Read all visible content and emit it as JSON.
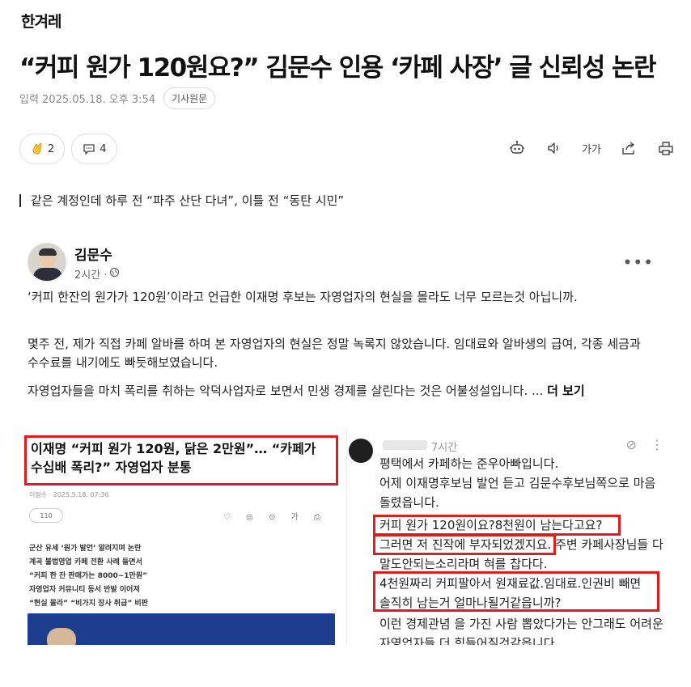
{
  "brand": {
    "logo": "한겨레"
  },
  "article": {
    "headline": "“커피 원가 120원요?” 김문수 인용 ‘카페 사장’ 글 신뢰성 논란",
    "date": "입력 2025.05.18. 오후 3:54",
    "source_button": "기사원문",
    "subhead": "같은 계정인데 하루 전 “파주 산단 다녀”, 이틀 전 “동탄 시민”"
  },
  "reactions": {
    "like_count": "2",
    "comment_count": "4"
  },
  "tools": {
    "font_size_label": "가가"
  },
  "post": {
    "author": "김문수",
    "time": "2시간 ·",
    "more": "•••",
    "paragraphs": [
      "‘커피 한잔의 원가가 120원’이라고 언급한 이재명 후보는 자영업자의 현실을 몰라도 너무 모르는것 아닙니까.",
      "몇주 전, 제가 직접 카페 알바를 하며 본 자영업자의 현실은 정말 녹록지 않았습니다. 임대료와 알바생의 급여, 각종 세금과 수수료를 내기에도 빠듯해보였습니다.",
      "자영업자들을 마치 폭리를 취하는 악덕사업자로 보면서 민생 경제를 살린다는 것은 어불성설입니다. ..."
    ],
    "see_more": "더 보기"
  },
  "left_thumb": {
    "title": "이재명 “커피 원가 120원, 닭은 2만원”… “카페가 수십배 폭리?” 자영업자 분통",
    "byline": "이정수 · 2025.5.18. 07:36",
    "count": "110",
    "icons": "♡ ◎ ⊙ 가 ⎙",
    "body": [
      "군산 유세 ‘원가 발언’ 알려지며 논란",
      "계곡 불법영업 카페 전환 사례 들면서",
      "“커피 한 잔 판매가는 8000~1만원”",
      "자영업자 커뮤니티 등서 반발 이어져",
      "“현실 몰라” “비가지 장사 취급” 비판"
    ]
  },
  "right_thumb": {
    "time": "7시간",
    "lines": [
      "평택에서 카페하는 준우아빠입니다.",
      "어제 이재명후보님 발언 듣고 김문수후보님쪽으로 마음",
      "돌렸읍니다.",
      "커피 원가 120원이요?8천원이 남는다고요?",
      "그러면 저 진작에 부자되었겠지요. 주변 카페사장님들 다",
      "말도안되는소리라며 혀를 찹다다.",
      "4천원짜리 커피팔아서 원재료값.임대료.인권비 빼면",
      "솔직히 남는거 얼마나될거같읍니까?",
      "이런 경제관념 을 가진 사람 뽑았다가는 안그래도 어려운",
      "자영업자들 더 힘들어질것같읍니다."
    ]
  },
  "colors": {
    "highlight_red": "#d82020",
    "text": "#111111",
    "muted": "#8a8a8a"
  }
}
